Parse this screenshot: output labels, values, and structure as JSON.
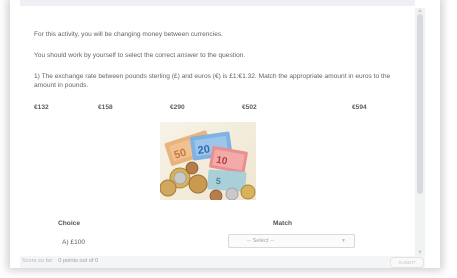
{
  "activity": {
    "intro": "For this activity, you will be changing money between currencies.",
    "instruction": "You should work by yourself to select the correct answer to the question.",
    "question": "1) The exchange rate between pounds sterling (£) and euros (€) is £1:€1.32. Match the appropriate amount in euros to the amount in pounds.",
    "amounts": [
      "€132",
      "€158",
      "€290",
      "€502",
      "€594"
    ]
  },
  "match_table": {
    "choice_header": "Choice",
    "match_header": "Match",
    "rows": [
      {
        "choice": "A) £100",
        "select_value": "-- Select --"
      }
    ]
  },
  "footer": {
    "score_label": "Score so far:",
    "score_value": "0 points out of 0",
    "submit_label": "SUBMIT"
  },
  "colors": {
    "text": "#5f646b",
    "panel_bg": "#ffffff",
    "footer_bg": "#f4f5f7",
    "scrollbar": "#d8dade"
  }
}
